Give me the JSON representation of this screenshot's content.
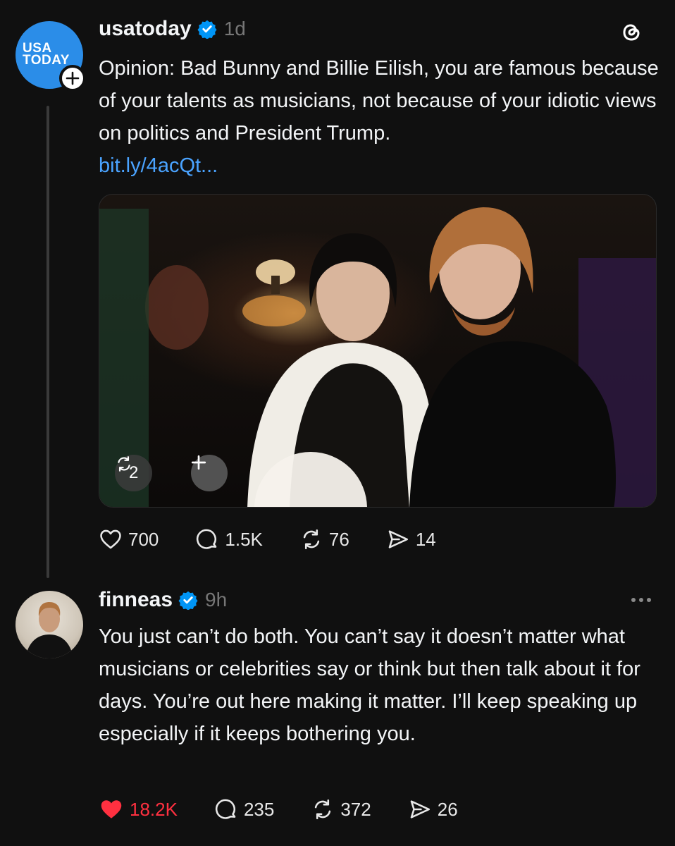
{
  "posts": [
    {
      "username": "usatoday",
      "time": "1d",
      "avatar_lines": [
        "USA",
        "TODAY"
      ],
      "text": "Opinion: Bad Bunny and Billie Eilish, you are famous because of your talents as musicians, not because of your idiotic views on politics and President Trump.",
      "link": "bit.ly/4acQt...",
      "media_badge_count": "2",
      "actions": {
        "likes": "700",
        "replies": "1.5K",
        "reposts": "76",
        "shares": "14"
      }
    },
    {
      "username": "finneas",
      "time": "9h",
      "text": "You just can’t do both. You can’t say it doesn’t matter what musicians or celebrities say or think but then talk about it for days. You’re out here making it matter. I’ll keep speaking up especially if it keeps bothering you.",
      "actions": {
        "likes": "18.2K",
        "replies": "235",
        "reposts": "372",
        "shares": "26"
      }
    }
  ],
  "icons": {
    "verified": "verified-badge-icon",
    "threads_logo": "threads-logo-icon",
    "more": "more-options-icon",
    "heart": "heart-icon",
    "reply": "reply-bubble-icon",
    "repost": "repost-icon",
    "share": "share-send-icon",
    "plus": "plus-icon"
  },
  "colors": {
    "background": "#101010",
    "link": "#4aa3ff",
    "verified": "#0095f6",
    "liked": "#ff3040",
    "usatoday_brand": "#2b8de8"
  }
}
